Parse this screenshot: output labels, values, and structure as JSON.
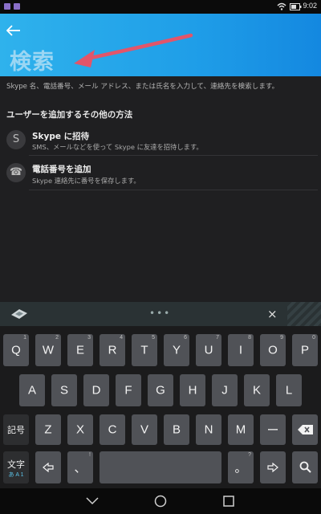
{
  "status_bar": {
    "time": "9:02"
  },
  "header": {
    "back_icon": "arrow-left-icon",
    "title": "検索",
    "color": "#1f9ee8"
  },
  "hint_text": "Skype 名、電話番号、メール アドレス、または氏名を入力して、連絡先を検索します。",
  "section_heading": "ユーザーを追加するその他の方法",
  "options": [
    {
      "icon": "skype-icon",
      "icon_glyph": "S",
      "title": "Skype に招待",
      "subtitle": "SMS、メールなどを使って Skype に友達を招待します。"
    },
    {
      "icon": "phone-icon",
      "icon_glyph": "☎",
      "title": "電話番号を追加",
      "subtitle": "Skype 連絡先に番号を保存します。"
    }
  ],
  "keyboard": {
    "close_label": "×",
    "row1": [
      {
        "k": "Q",
        "n": "1"
      },
      {
        "k": "W",
        "n": "2"
      },
      {
        "k": "E",
        "n": "3"
      },
      {
        "k": "R",
        "n": "4"
      },
      {
        "k": "T",
        "n": "5"
      },
      {
        "k": "Y",
        "n": "6"
      },
      {
        "k": "U",
        "n": "7"
      },
      {
        "k": "I",
        "n": "8"
      },
      {
        "k": "O",
        "n": "9"
      },
      {
        "k": "P",
        "n": "0"
      }
    ],
    "row2": [
      "A",
      "S",
      "D",
      "F",
      "G",
      "H",
      "J",
      "K",
      "L"
    ],
    "row3_symbol_key": "記号",
    "row3": [
      "Z",
      "X",
      "C",
      "V",
      "B",
      "N",
      "M"
    ],
    "row3_dash": "ー",
    "row4_mode_key": "文字",
    "row4_mode_sub": "あ A 1",
    "row4_comma": "、",
    "row4_comma_hint": "!",
    "row4_period": "。",
    "row4_period_hint": "?"
  }
}
